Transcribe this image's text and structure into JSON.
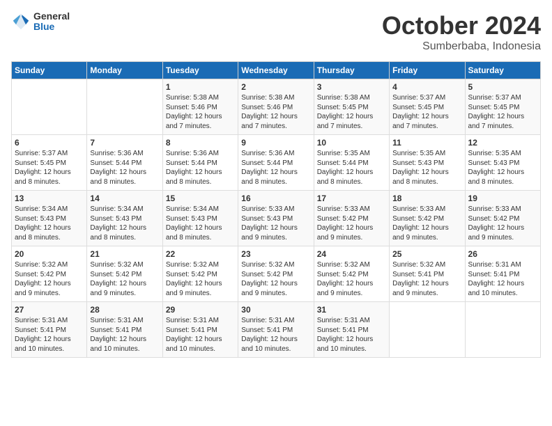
{
  "logo": {
    "general": "General",
    "blue": "Blue"
  },
  "header": {
    "month": "October 2024",
    "location": "Sumberbaba, Indonesia"
  },
  "weekdays": [
    "Sunday",
    "Monday",
    "Tuesday",
    "Wednesday",
    "Thursday",
    "Friday",
    "Saturday"
  ],
  "weeks": [
    [
      null,
      null,
      {
        "day": 1,
        "sunrise": "5:38 AM",
        "sunset": "5:46 PM",
        "daylight": "12 hours and 7 minutes."
      },
      {
        "day": 2,
        "sunrise": "5:38 AM",
        "sunset": "5:46 PM",
        "daylight": "12 hours and 7 minutes."
      },
      {
        "day": 3,
        "sunrise": "5:38 AM",
        "sunset": "5:45 PM",
        "daylight": "12 hours and 7 minutes."
      },
      {
        "day": 4,
        "sunrise": "5:37 AM",
        "sunset": "5:45 PM",
        "daylight": "12 hours and 7 minutes."
      },
      {
        "day": 5,
        "sunrise": "5:37 AM",
        "sunset": "5:45 PM",
        "daylight": "12 hours and 7 minutes."
      }
    ],
    [
      {
        "day": 6,
        "sunrise": "5:37 AM",
        "sunset": "5:45 PM",
        "daylight": "12 hours and 8 minutes."
      },
      {
        "day": 7,
        "sunrise": "5:36 AM",
        "sunset": "5:44 PM",
        "daylight": "12 hours and 8 minutes."
      },
      {
        "day": 8,
        "sunrise": "5:36 AM",
        "sunset": "5:44 PM",
        "daylight": "12 hours and 8 minutes."
      },
      {
        "day": 9,
        "sunrise": "5:36 AM",
        "sunset": "5:44 PM",
        "daylight": "12 hours and 8 minutes."
      },
      {
        "day": 10,
        "sunrise": "5:35 AM",
        "sunset": "5:44 PM",
        "daylight": "12 hours and 8 minutes."
      },
      {
        "day": 11,
        "sunrise": "5:35 AM",
        "sunset": "5:43 PM",
        "daylight": "12 hours and 8 minutes."
      },
      {
        "day": 12,
        "sunrise": "5:35 AM",
        "sunset": "5:43 PM",
        "daylight": "12 hours and 8 minutes."
      }
    ],
    [
      {
        "day": 13,
        "sunrise": "5:34 AM",
        "sunset": "5:43 PM",
        "daylight": "12 hours and 8 minutes."
      },
      {
        "day": 14,
        "sunrise": "5:34 AM",
        "sunset": "5:43 PM",
        "daylight": "12 hours and 8 minutes."
      },
      {
        "day": 15,
        "sunrise": "5:34 AM",
        "sunset": "5:43 PM",
        "daylight": "12 hours and 8 minutes."
      },
      {
        "day": 16,
        "sunrise": "5:33 AM",
        "sunset": "5:43 PM",
        "daylight": "12 hours and 9 minutes."
      },
      {
        "day": 17,
        "sunrise": "5:33 AM",
        "sunset": "5:42 PM",
        "daylight": "12 hours and 9 minutes."
      },
      {
        "day": 18,
        "sunrise": "5:33 AM",
        "sunset": "5:42 PM",
        "daylight": "12 hours and 9 minutes."
      },
      {
        "day": 19,
        "sunrise": "5:33 AM",
        "sunset": "5:42 PM",
        "daylight": "12 hours and 9 minutes."
      }
    ],
    [
      {
        "day": 20,
        "sunrise": "5:32 AM",
        "sunset": "5:42 PM",
        "daylight": "12 hours and 9 minutes."
      },
      {
        "day": 21,
        "sunrise": "5:32 AM",
        "sunset": "5:42 PM",
        "daylight": "12 hours and 9 minutes."
      },
      {
        "day": 22,
        "sunrise": "5:32 AM",
        "sunset": "5:42 PM",
        "daylight": "12 hours and 9 minutes."
      },
      {
        "day": 23,
        "sunrise": "5:32 AM",
        "sunset": "5:42 PM",
        "daylight": "12 hours and 9 minutes."
      },
      {
        "day": 24,
        "sunrise": "5:32 AM",
        "sunset": "5:42 PM",
        "daylight": "12 hours and 9 minutes."
      },
      {
        "day": 25,
        "sunrise": "5:32 AM",
        "sunset": "5:41 PM",
        "daylight": "12 hours and 9 minutes."
      },
      {
        "day": 26,
        "sunrise": "5:31 AM",
        "sunset": "5:41 PM",
        "daylight": "12 hours and 10 minutes."
      }
    ],
    [
      {
        "day": 27,
        "sunrise": "5:31 AM",
        "sunset": "5:41 PM",
        "daylight": "12 hours and 10 minutes."
      },
      {
        "day": 28,
        "sunrise": "5:31 AM",
        "sunset": "5:41 PM",
        "daylight": "12 hours and 10 minutes."
      },
      {
        "day": 29,
        "sunrise": "5:31 AM",
        "sunset": "5:41 PM",
        "daylight": "12 hours and 10 minutes."
      },
      {
        "day": 30,
        "sunrise": "5:31 AM",
        "sunset": "5:41 PM",
        "daylight": "12 hours and 10 minutes."
      },
      {
        "day": 31,
        "sunrise": "5:31 AM",
        "sunset": "5:41 PM",
        "daylight": "12 hours and 10 minutes."
      },
      null,
      null
    ]
  ]
}
